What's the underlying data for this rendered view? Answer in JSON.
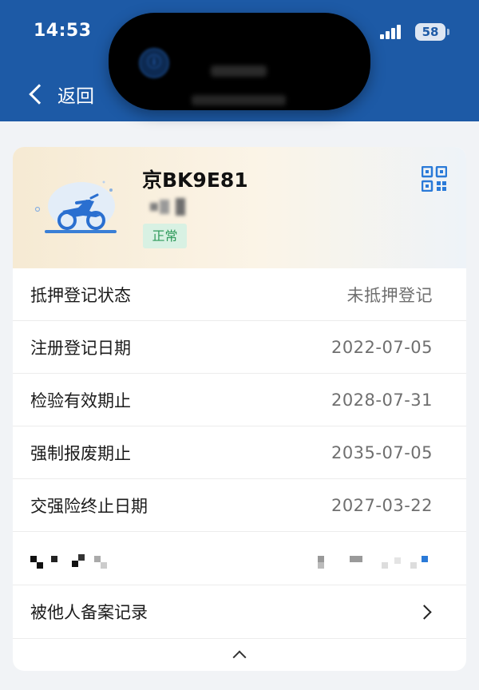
{
  "status_bar": {
    "time": "14:53",
    "battery": "58"
  },
  "nav": {
    "back_label": "返回"
  },
  "vehicle": {
    "plate": "京BK9E81",
    "status": "正常"
  },
  "details": [
    {
      "label": "抵押登记状态",
      "value": "未抵押登记"
    },
    {
      "label": "注册登记日期",
      "value": "2022-07-05"
    },
    {
      "label": "检验有效期止",
      "value": "2028-07-31"
    },
    {
      "label": "强制报废期止",
      "value": "2035-07-05"
    },
    {
      "label": "交强险终止日期",
      "value": "2027-03-22"
    }
  ],
  "records": {
    "label": "被他人备案记录"
  },
  "colors": {
    "header_bg": "#1d5aa6",
    "badge_bg": "#d8f1e3",
    "badge_text": "#2f9a5b",
    "accent_blue": "#2a7ad8"
  },
  "icons": {
    "back": "chevron-left-icon",
    "qr": "qr-code-icon",
    "records": "chevron-right-icon",
    "collapse": "chevron-up-icon",
    "vehicle": "motorcycle-icon"
  }
}
